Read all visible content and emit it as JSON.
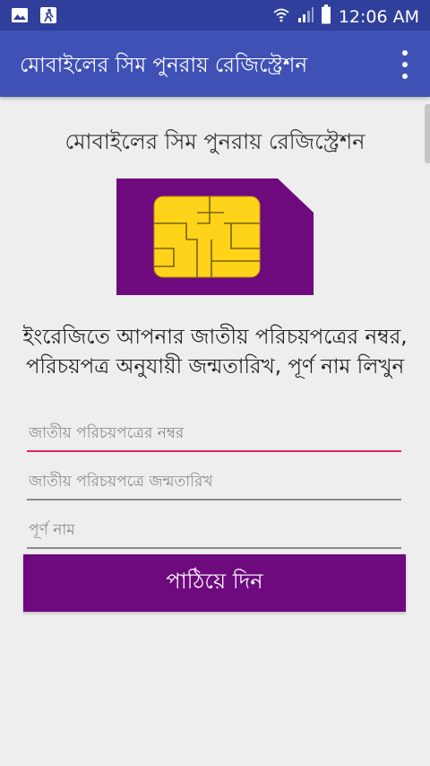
{
  "status_bar": {
    "time": "12:06 AM",
    "icons": [
      "gallery-icon",
      "accessibility-icon",
      "wifi-icon",
      "signal-icon",
      "battery-icon"
    ]
  },
  "app_bar": {
    "title": "মোবাইলের সিম পুনরায় রেজিস্ট্রেশন",
    "menu_icon": "overflow-menu-icon"
  },
  "main": {
    "heading": "মোবাইলের সিম পুনরায় রেজিস্ট্রেশন",
    "instructions": "ইংরেজিতে আপনার জাতীয় পরিচয়পত্রের নম্বর, পরিচয়পত্র অনুযায়ী জন্মতারিখ, পূর্ণ নাম লিখুন",
    "fields": {
      "nid": {
        "placeholder": "জাতীয় পরিচয়পত্রের নম্বর",
        "value": ""
      },
      "dob": {
        "placeholder": "জাতীয় পরিচয়পত্রে জন্মতারিখ",
        "value": ""
      },
      "name": {
        "placeholder": "পূর্ণ নাম",
        "value": ""
      }
    },
    "submit_label": "পাঠিয়ে দিন"
  },
  "colors": {
    "status_bar": "#2f3f9b",
    "app_bar": "#3f51b5",
    "sim_card": "#6e0a7e",
    "chip": "#ffd31a",
    "button": "#6e0a7e",
    "active_underline": "#e0245e"
  }
}
